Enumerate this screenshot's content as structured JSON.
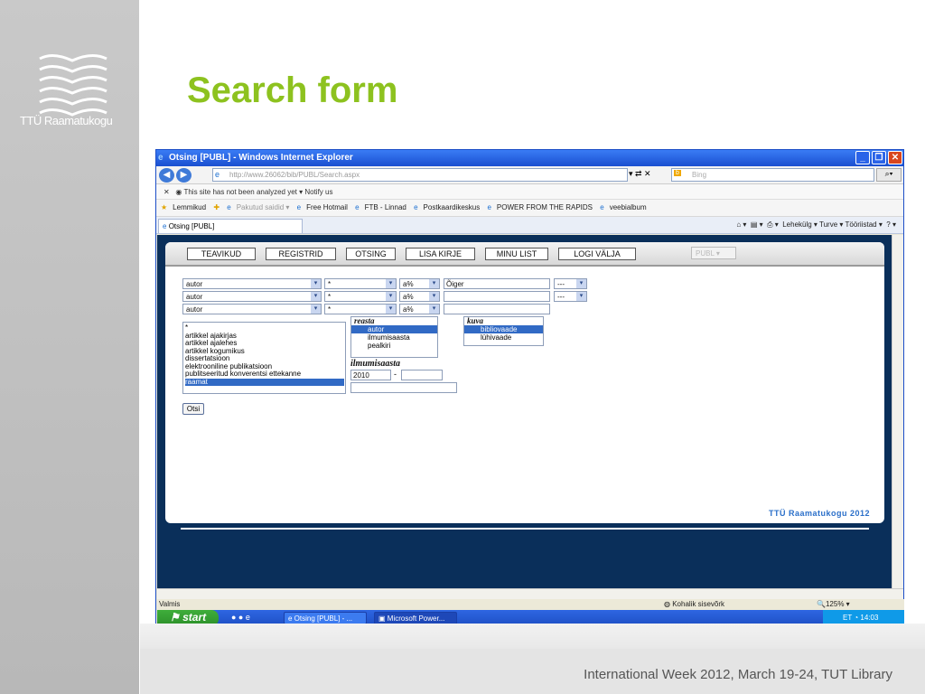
{
  "slide": {
    "title": "Search form",
    "footer": "International Week 2012, March 19-24, TUT Library",
    "logo_text": "TTÜ Raamatukogu"
  },
  "browser": {
    "title": "Otsing [PUBL] - Windows Internet Explorer",
    "url": "http://www.26062/bib/PUBL/Search.aspx",
    "search_placeholder": "Bing",
    "infobar_text": "This site has not been analyzed yet ▾",
    "notify": "Notify us",
    "favorites": [
      "Lemmikud",
      "Pakutud saidid ▾",
      "Free Hotmail",
      "FTB - Linnad",
      "Postkaardikeskus",
      "POWER FROM THE RAPIDS",
      "veebialbum"
    ],
    "tab": "Otsing [PUBL]",
    "commands": "Lehekülg ▾   Turve ▾   Tööriistad ▾",
    "status": "Valmis",
    "zone": "Kohalik sisevõrk",
    "zoom": "125%"
  },
  "app": {
    "nav": [
      "TEAVIKUD",
      "REGISTRID",
      "OTSING",
      "LISA KIRJE",
      "MINU LIST",
      "LOGI VÄLJA"
    ],
    "db_select": "PUBL",
    "rows": [
      {
        "field": "autor",
        "op": "*",
        "mode": "a%",
        "value": "Õiger",
        "bool": "---"
      },
      {
        "field": "autor",
        "op": "*",
        "mode": "a%",
        "value": "",
        "bool": "---"
      },
      {
        "field": "autor",
        "op": "*",
        "mode": "a%",
        "value": "",
        "bool": ""
      }
    ],
    "types": [
      "*",
      "artikkel ajakirjas",
      "artikkel ajalehes",
      "artikkel kogumikus",
      "dissertatsioon",
      "elektrooniline publikatsioon",
      "publitseeritud konverentsi ettekanne",
      "raamat"
    ],
    "sort_label": "reasta",
    "sort_options": [
      "autor",
      "ilmumisaasta",
      "pealkiri"
    ],
    "view_label": "kuva",
    "view_options": [
      "bibliovaade",
      "lühivaade"
    ],
    "year_label": "ilmumisaasta",
    "year_from": "2010",
    "year_sep": "-",
    "search_button": "Otsi",
    "brand": "TTÜ Raamatukogu 2012"
  },
  "taskbar": {
    "start": "start",
    "tasks": [
      "Otsing [PUBL] - ...",
      "Microsoft Power..."
    ],
    "lang": "ET",
    "time": "14:03"
  }
}
